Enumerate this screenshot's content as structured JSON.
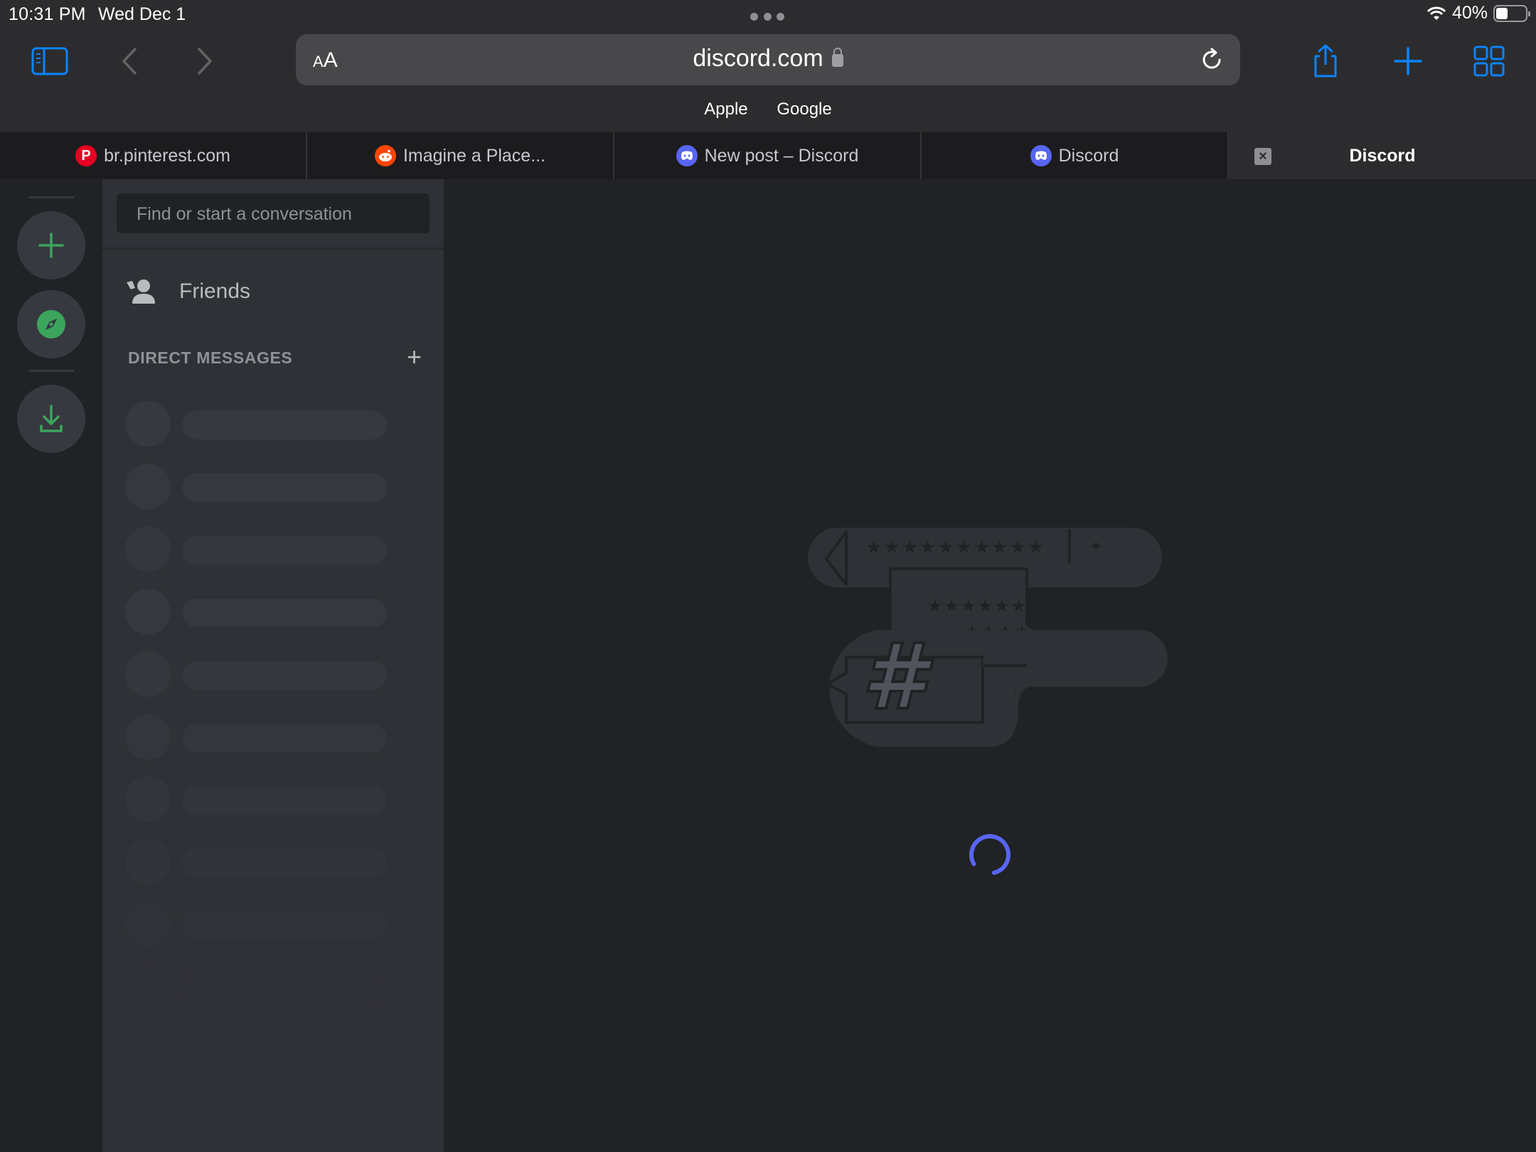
{
  "status_bar": {
    "time": "10:31 PM",
    "date": "Wed Dec 1",
    "battery": "40%",
    "battery_level": 0.4
  },
  "browser": {
    "url_aa": "AA",
    "url": "discord.com",
    "bookmarks": [
      "Apple",
      "Google"
    ],
    "icons": {
      "sidebar": "sidebar-icon",
      "back": "chevron-left-icon",
      "forward": "chevron-right-icon",
      "reload": "reload-icon",
      "share": "share-icon",
      "new_tab": "plus-icon",
      "tabs_overview": "grid-icon"
    },
    "accent_color": "#0a84ff"
  },
  "tabs": [
    {
      "title": "br.pinterest.com",
      "favicon": "P",
      "active": false
    },
    {
      "title": "Imagine a Place...",
      "favicon": "reddit",
      "active": false
    },
    {
      "title": "New post – Discord",
      "favicon": "discord",
      "active": false
    },
    {
      "title": "Discord",
      "favicon": "discord",
      "active": false
    },
    {
      "title": "Discord",
      "favicon": "close",
      "active": true
    }
  ],
  "discord": {
    "search_placeholder": "Find or start a conversation",
    "friends_label": "Friends",
    "direct_messages_header": "DIRECT MESSAGES",
    "add_dm_label": "+",
    "guild_buttons": [
      "add-server-icon",
      "explore-servers-icon",
      "download-apps-icon"
    ],
    "accent_green": "#3ba55c",
    "brand_color": "#5865f2",
    "dm_placeholders": 10,
    "loading": true
  }
}
